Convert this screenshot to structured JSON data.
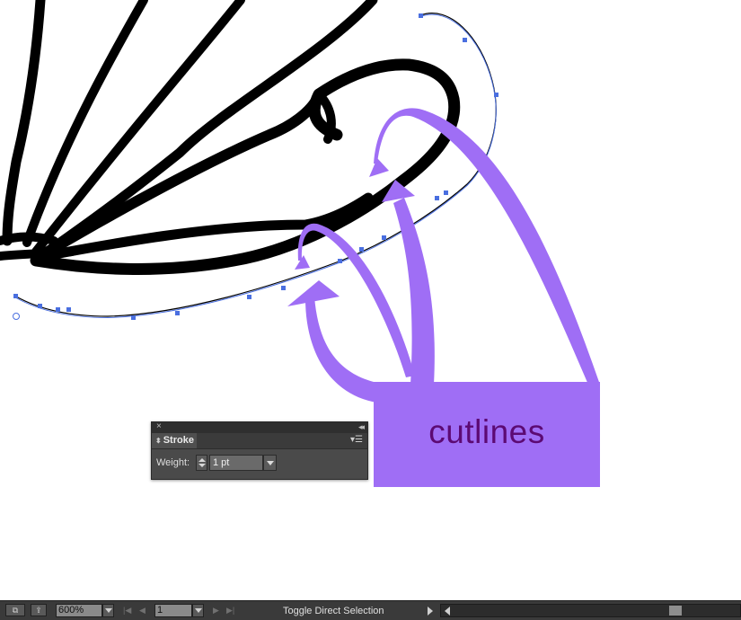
{
  "canvas": {
    "callout_label": "cutlines",
    "arrow_color": "#9f6ef5",
    "label_color": "#5c0a73",
    "path_color": "#4a6fe0"
  },
  "stroke_panel": {
    "tab_label": "Stroke",
    "close_glyph": "×",
    "collapse_glyph": "◂◂",
    "menu_glyph": "▾☰",
    "weight_label": "Weight:",
    "weight_value": "1 pt"
  },
  "status_bar": {
    "zoom_value": "600%",
    "page_value": "1",
    "status_text": "Toggle Direct Selection"
  }
}
